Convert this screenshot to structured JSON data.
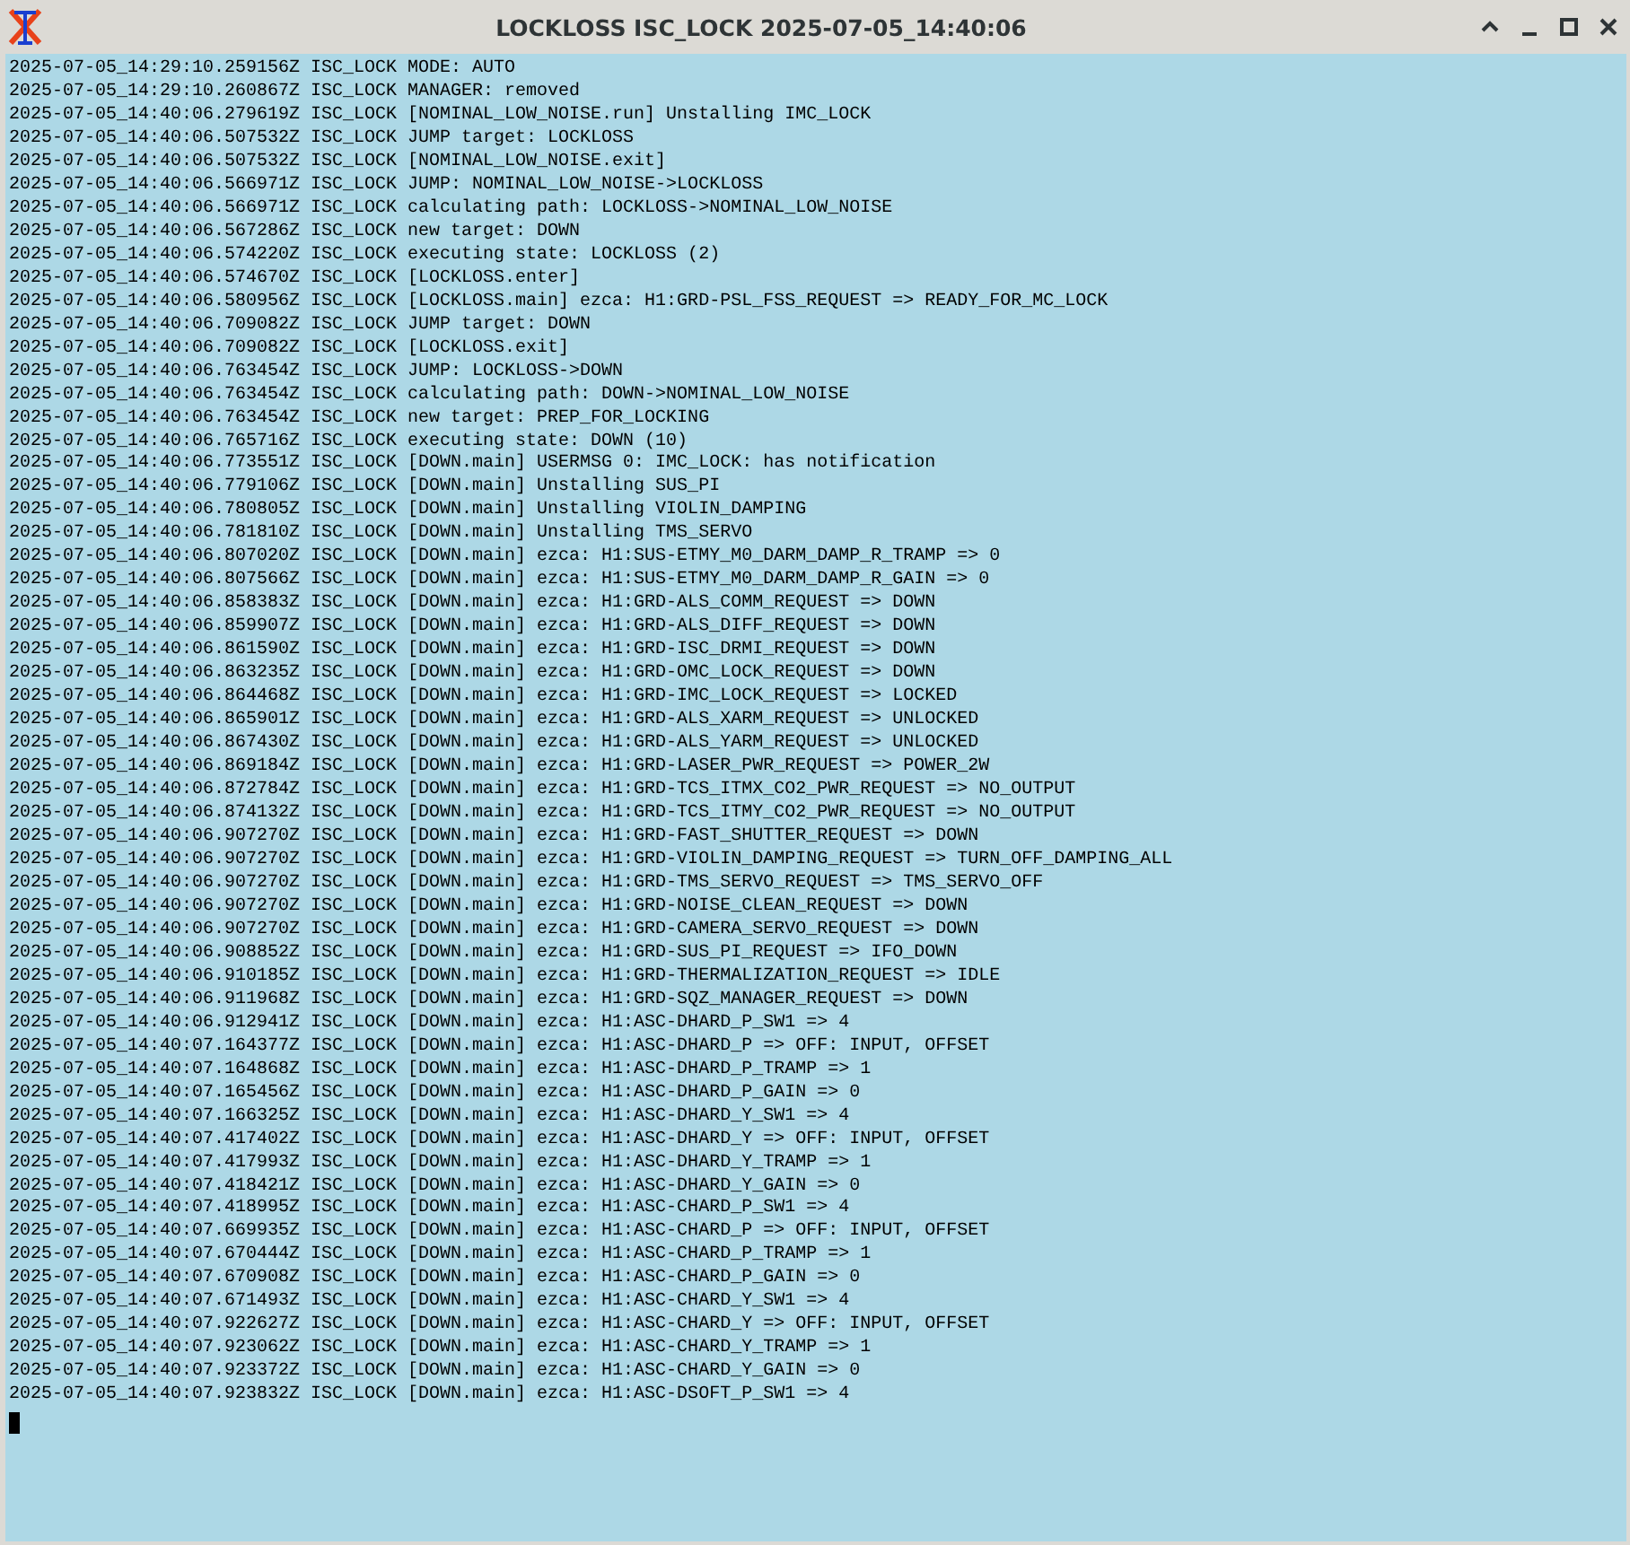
{
  "window": {
    "title": "LOCKLOSS ISC_LOCK 2025-07-05_14:40:06"
  },
  "lines": [
    "2025-07-05_14:29:10.259156Z ISC_LOCK MODE: AUTO",
    "2025-07-05_14:29:10.260867Z ISC_LOCK MANAGER: removed",
    "2025-07-05_14:40:06.279619Z ISC_LOCK [NOMINAL_LOW_NOISE.run] Unstalling IMC_LOCK",
    "2025-07-05_14:40:06.507532Z ISC_LOCK JUMP target: LOCKLOSS",
    "2025-07-05_14:40:06.507532Z ISC_LOCK [NOMINAL_LOW_NOISE.exit]",
    "2025-07-05_14:40:06.566971Z ISC_LOCK JUMP: NOMINAL_LOW_NOISE->LOCKLOSS",
    "2025-07-05_14:40:06.566971Z ISC_LOCK calculating path: LOCKLOSS->NOMINAL_LOW_NOISE",
    "2025-07-05_14:40:06.567286Z ISC_LOCK new target: DOWN",
    "2025-07-05_14:40:06.574220Z ISC_LOCK executing state: LOCKLOSS (2)",
    "2025-07-05_14:40:06.574670Z ISC_LOCK [LOCKLOSS.enter]",
    "2025-07-05_14:40:06.580956Z ISC_LOCK [LOCKLOSS.main] ezca: H1:GRD-PSL_FSS_REQUEST => READY_FOR_MC_LOCK",
    "2025-07-05_14:40:06.709082Z ISC_LOCK JUMP target: DOWN",
    "2025-07-05_14:40:06.709082Z ISC_LOCK [LOCKLOSS.exit]",
    "2025-07-05_14:40:06.763454Z ISC_LOCK JUMP: LOCKLOSS->DOWN",
    "2025-07-05_14:40:06.763454Z ISC_LOCK calculating path: DOWN->NOMINAL_LOW_NOISE",
    "2025-07-05_14:40:06.763454Z ISC_LOCK new target: PREP_FOR_LOCKING",
    "2025-07-05_14:40:06.765716Z ISC_LOCK executing state: DOWN (10)",
    "2025-07-05_14:40:06.773551Z ISC_LOCK [DOWN.main] USERMSG 0: IMC_LOCK: has notification",
    "2025-07-05_14:40:06.779106Z ISC_LOCK [DOWN.main] Unstalling SUS_PI",
    "2025-07-05_14:40:06.780805Z ISC_LOCK [DOWN.main] Unstalling VIOLIN_DAMPING",
    "2025-07-05_14:40:06.781810Z ISC_LOCK [DOWN.main] Unstalling TMS_SERVO",
    "2025-07-05_14:40:06.807020Z ISC_LOCK [DOWN.main] ezca: H1:SUS-ETMY_M0_DARM_DAMP_R_TRAMP => 0",
    "2025-07-05_14:40:06.807566Z ISC_LOCK [DOWN.main] ezca: H1:SUS-ETMY_M0_DARM_DAMP_R_GAIN => 0",
    "2025-07-05_14:40:06.858383Z ISC_LOCK [DOWN.main] ezca: H1:GRD-ALS_COMM_REQUEST => DOWN",
    "2025-07-05_14:40:06.859907Z ISC_LOCK [DOWN.main] ezca: H1:GRD-ALS_DIFF_REQUEST => DOWN",
    "2025-07-05_14:40:06.861590Z ISC_LOCK [DOWN.main] ezca: H1:GRD-ISC_DRMI_REQUEST => DOWN",
    "2025-07-05_14:40:06.863235Z ISC_LOCK [DOWN.main] ezca: H1:GRD-OMC_LOCK_REQUEST => DOWN",
    "2025-07-05_14:40:06.864468Z ISC_LOCK [DOWN.main] ezca: H1:GRD-IMC_LOCK_REQUEST => LOCKED",
    "2025-07-05_14:40:06.865901Z ISC_LOCK [DOWN.main] ezca: H1:GRD-ALS_XARM_REQUEST => UNLOCKED",
    "2025-07-05_14:40:06.867430Z ISC_LOCK [DOWN.main] ezca: H1:GRD-ALS_YARM_REQUEST => UNLOCKED",
    "2025-07-05_14:40:06.869184Z ISC_LOCK [DOWN.main] ezca: H1:GRD-LASER_PWR_REQUEST => POWER_2W",
    "2025-07-05_14:40:06.872784Z ISC_LOCK [DOWN.main] ezca: H1:GRD-TCS_ITMX_CO2_PWR_REQUEST => NO_OUTPUT",
    "2025-07-05_14:40:06.874132Z ISC_LOCK [DOWN.main] ezca: H1:GRD-TCS_ITMY_CO2_PWR_REQUEST => NO_OUTPUT",
    "2025-07-05_14:40:06.907270Z ISC_LOCK [DOWN.main] ezca: H1:GRD-FAST_SHUTTER_REQUEST => DOWN",
    "2025-07-05_14:40:06.907270Z ISC_LOCK [DOWN.main] ezca: H1:GRD-VIOLIN_DAMPING_REQUEST => TURN_OFF_DAMPING_ALL",
    "2025-07-05_14:40:06.907270Z ISC_LOCK [DOWN.main] ezca: H1:GRD-TMS_SERVO_REQUEST => TMS_SERVO_OFF",
    "2025-07-05_14:40:06.907270Z ISC_LOCK [DOWN.main] ezca: H1:GRD-NOISE_CLEAN_REQUEST => DOWN",
    "2025-07-05_14:40:06.907270Z ISC_LOCK [DOWN.main] ezca: H1:GRD-CAMERA_SERVO_REQUEST => DOWN",
    "2025-07-05_14:40:06.908852Z ISC_LOCK [DOWN.main] ezca: H1:GRD-SUS_PI_REQUEST => IFO_DOWN",
    "2025-07-05_14:40:06.910185Z ISC_LOCK [DOWN.main] ezca: H1:GRD-THERMALIZATION_REQUEST => IDLE",
    "2025-07-05_14:40:06.911968Z ISC_LOCK [DOWN.main] ezca: H1:GRD-SQZ_MANAGER_REQUEST => DOWN",
    "2025-07-05_14:40:06.912941Z ISC_LOCK [DOWN.main] ezca: H1:ASC-DHARD_P_SW1 => 4",
    "2025-07-05_14:40:07.164377Z ISC_LOCK [DOWN.main] ezca: H1:ASC-DHARD_P => OFF: INPUT, OFFSET",
    "2025-07-05_14:40:07.164868Z ISC_LOCK [DOWN.main] ezca: H1:ASC-DHARD_P_TRAMP => 1",
    "2025-07-05_14:40:07.165456Z ISC_LOCK [DOWN.main] ezca: H1:ASC-DHARD_P_GAIN => 0",
    "2025-07-05_14:40:07.166325Z ISC_LOCK [DOWN.main] ezca: H1:ASC-DHARD_Y_SW1 => 4",
    "2025-07-05_14:40:07.417402Z ISC_LOCK [DOWN.main] ezca: H1:ASC-DHARD_Y => OFF: INPUT, OFFSET",
    "2025-07-05_14:40:07.417993Z ISC_LOCK [DOWN.main] ezca: H1:ASC-DHARD_Y_TRAMP => 1",
    "2025-07-05_14:40:07.418421Z ISC_LOCK [DOWN.main] ezca: H1:ASC-DHARD_Y_GAIN => 0",
    "2025-07-05_14:40:07.418995Z ISC_LOCK [DOWN.main] ezca: H1:ASC-CHARD_P_SW1 => 4",
    "2025-07-05_14:40:07.669935Z ISC_LOCK [DOWN.main] ezca: H1:ASC-CHARD_P => OFF: INPUT, OFFSET",
    "2025-07-05_14:40:07.670444Z ISC_LOCK [DOWN.main] ezca: H1:ASC-CHARD_P_TRAMP => 1",
    "2025-07-05_14:40:07.670908Z ISC_LOCK [DOWN.main] ezca: H1:ASC-CHARD_P_GAIN => 0",
    "2025-07-05_14:40:07.671493Z ISC_LOCK [DOWN.main] ezca: H1:ASC-CHARD_Y_SW1 => 4",
    "2025-07-05_14:40:07.922627Z ISC_LOCK [DOWN.main] ezca: H1:ASC-CHARD_Y => OFF: INPUT, OFFSET",
    "2025-07-05_14:40:07.923062Z ISC_LOCK [DOWN.main] ezca: H1:ASC-CHARD_Y_TRAMP => 1",
    "2025-07-05_14:40:07.923372Z ISC_LOCK [DOWN.main] ezca: H1:ASC-CHARD_Y_GAIN => 0",
    "2025-07-05_14:40:07.923832Z ISC_LOCK [DOWN.main] ezca: H1:ASC-DSOFT_P_SW1 => 4"
  ]
}
